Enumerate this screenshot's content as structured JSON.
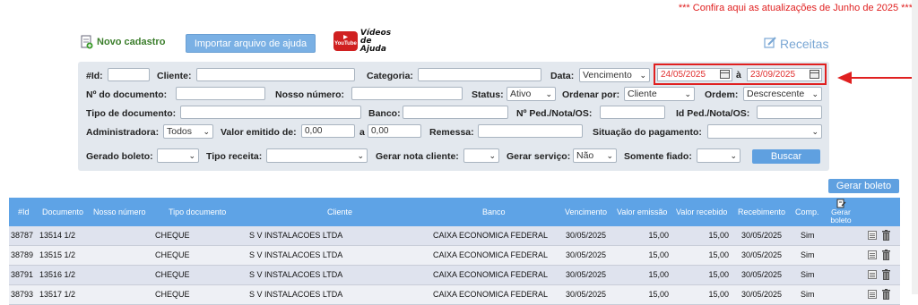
{
  "update_notice": "*** Confira aqui as atualizações de Junho de 2025 ***",
  "toolbar": {
    "novo_cadastro": "Novo cadastro",
    "importar": "Importar arquivo de ajuda",
    "videos_line1": "Vídeos",
    "videos_line2": "de Ajuda",
    "youtube": "YouTube",
    "receitas": "Receitas"
  },
  "filters": {
    "id_label": "#Id:",
    "id_value": "",
    "cliente_label": "Cliente:",
    "cliente_value": "",
    "categoria_label": "Categoria:",
    "categoria_value": "",
    "data_label": "Data:",
    "data_select": "Vencimento",
    "date_from": "24/05/2025",
    "date_sep": "à",
    "date_to": "23/09/2025",
    "num_doc_label": "Nº do documento:",
    "nosso_numero_label": "Nosso número:",
    "status_label": "Status:",
    "status_select": "Ativo",
    "ordenar_label": "Ordenar por:",
    "ordenar_select": "Cliente",
    "ordem_label": "Ordem:",
    "ordem_select": "Descrescente",
    "tipo_doc_label": "Tipo de documento:",
    "banco_label": "Banco:",
    "num_ped_label": "Nº Ped./Nota/OS:",
    "id_ped_label": "Id Ped./Nota/OS:",
    "administradora_label": "Administradora:",
    "administradora_select": "Todos",
    "valor_emitido_label": "Valor emitido de:",
    "valor_de": "0,00",
    "valor_sep": "a",
    "valor_ate": "0,00",
    "remessa_label": "Remessa:",
    "situacao_label": "Situação do pagamento:",
    "situacao_select": "",
    "gerado_boleto_label": "Gerado boleto:",
    "gerado_boleto_select": "",
    "tipo_receita_label": "Tipo receita:",
    "tipo_receita_select": "",
    "gerar_nota_label": "Gerar nota cliente:",
    "gerar_nota_select": "",
    "gerar_servico_label": "Gerar serviço:",
    "gerar_servico_select": "Não",
    "somente_fiado_label": "Somente fiado:",
    "somente_fiado_select": "",
    "buscar": "Buscar"
  },
  "gerar_boleto_button": "Gerar boleto",
  "table": {
    "headers": {
      "id": "#Id",
      "documento": "Documento",
      "nosso_numero": "Nosso número",
      "tipo_documento": "Tipo documento",
      "cliente": "Cliente",
      "banco": "Banco",
      "vencimento": "Vencimento",
      "valor_emissao": "Valor emissão",
      "valor_recebido": "Valor recebido",
      "recebimento": "Recebimento",
      "comp": "Comp.",
      "gerar_boleto_1": "Gerar",
      "gerar_boleto_2": "boleto"
    },
    "rows": [
      {
        "id": "38787",
        "documento": "13514 1/2",
        "tipo": "CHEQUE",
        "cliente": "S V INSTALACOES LTDA",
        "banco": "CAIXA ECONOMICA FEDERAL",
        "vencimento": "30/05/2025",
        "valor_emissao": "15,00",
        "valor_recebido": "15,00",
        "recebimento": "30/05/2025",
        "comp": "Sim"
      },
      {
        "id": "38789",
        "documento": "13515 1/2",
        "tipo": "CHEQUE",
        "cliente": "S V INSTALACOES LTDA",
        "banco": "CAIXA ECONOMICA FEDERAL",
        "vencimento": "30/05/2025",
        "valor_emissao": "15,00",
        "valor_recebido": "15,00",
        "recebimento": "30/05/2025",
        "comp": "Sim"
      },
      {
        "id": "38791",
        "documento": "13516 1/2",
        "tipo": "CHEQUE",
        "cliente": "S V INSTALACOES LTDA",
        "banco": "CAIXA ECONOMICA FEDERAL",
        "vencimento": "30/05/2025",
        "valor_emissao": "15,00",
        "valor_recebido": "15,00",
        "recebimento": "30/05/2025",
        "comp": "Sim"
      },
      {
        "id": "38793",
        "documento": "13517 1/2",
        "tipo": "CHEQUE",
        "cliente": "S V INSTALACOES LTDA",
        "banco": "CAIXA ECONOMICA FEDERAL",
        "vencimento": "30/05/2025",
        "valor_emissao": "15,00",
        "valor_recebido": "15,00",
        "recebimento": "30/05/2025",
        "comp": "Sim"
      }
    ]
  },
  "colors": {
    "accent": "#5ea3e6",
    "highlight": "#e02020",
    "novo_cadastro": "#3a7d2a"
  }
}
